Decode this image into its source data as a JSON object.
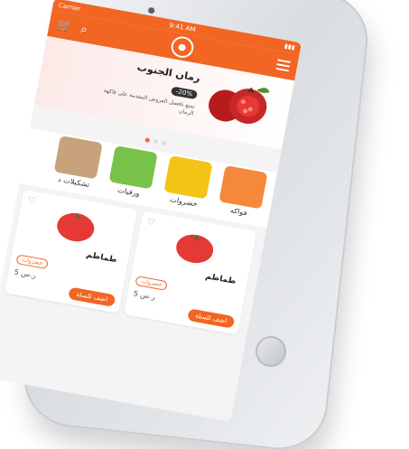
{
  "status": {
    "carrier": "Carrier",
    "time": "9:41 AM"
  },
  "topbar": {
    "cart_icon": "cart-icon",
    "search_icon": "search-icon",
    "logo_icon": "pomegranate-logo-icon",
    "menu_icon": "menu-icon"
  },
  "banner": {
    "title": "رمان الجنوب",
    "discount": "-20%",
    "text": "تمتع بافضل العروض المقدمة على فاكهة الرمان"
  },
  "categories": [
    {
      "label": "فواكه"
    },
    {
      "label": "خضروات"
    },
    {
      "label": "ورقيات"
    },
    {
      "label": "تشكيلات د"
    }
  ],
  "products": [
    {
      "name": "طماطم",
      "tag": "خضروات",
      "price": "5 ر.س",
      "add": "اضف للسلة"
    },
    {
      "name": "طماطم",
      "tag": "خضروات",
      "price": "5 ر.س",
      "add": "اضف للسلة"
    }
  ],
  "colors": {
    "accent": "#f26522"
  }
}
